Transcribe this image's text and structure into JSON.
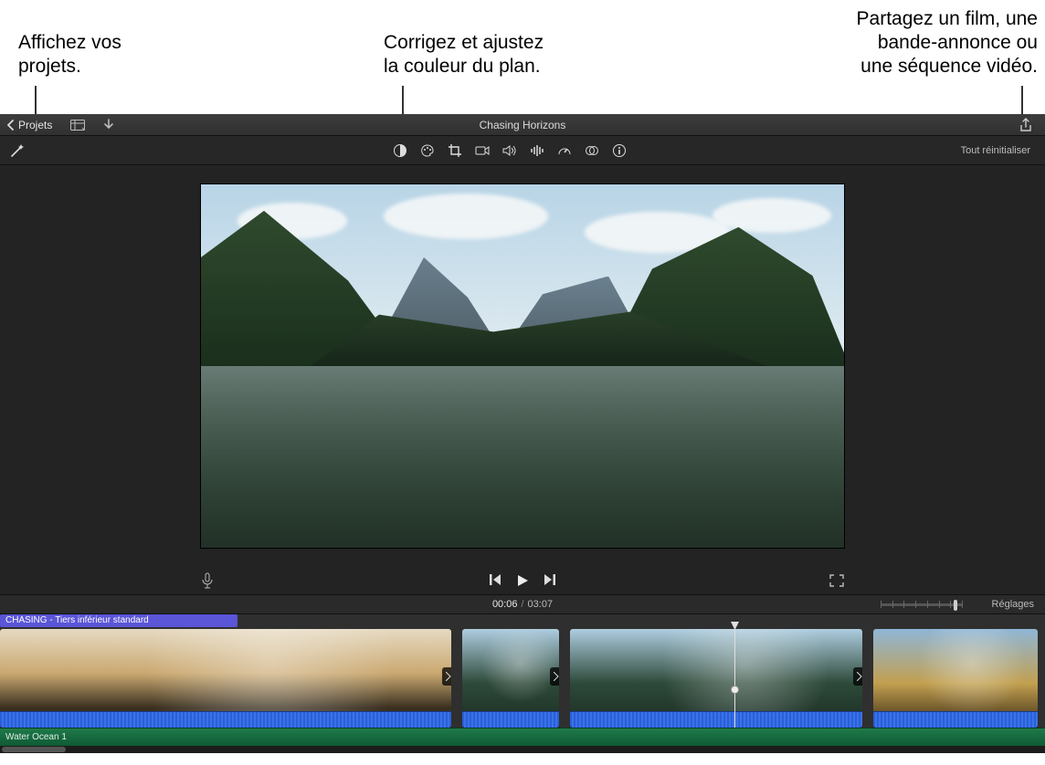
{
  "callouts": {
    "projects": "Affichez vos\nprojets.",
    "color": "Corrigez et ajustez\nla couleur du plan.",
    "share": "Partagez un film, une\nbande-annonce ou\nune séquence vidéo."
  },
  "topbar": {
    "back_label": "Projets",
    "title": "Chasing Horizons"
  },
  "adjustbar": {
    "reset_label": "Tout réinitialiser"
  },
  "timecode": {
    "current": "00:06",
    "sep": "/",
    "total": "03:07",
    "settings_label": "Réglages"
  },
  "timeline": {
    "title_clip": "CHASING - Tiers inférieur standard",
    "audio_clip": "Water Ocean 1"
  }
}
